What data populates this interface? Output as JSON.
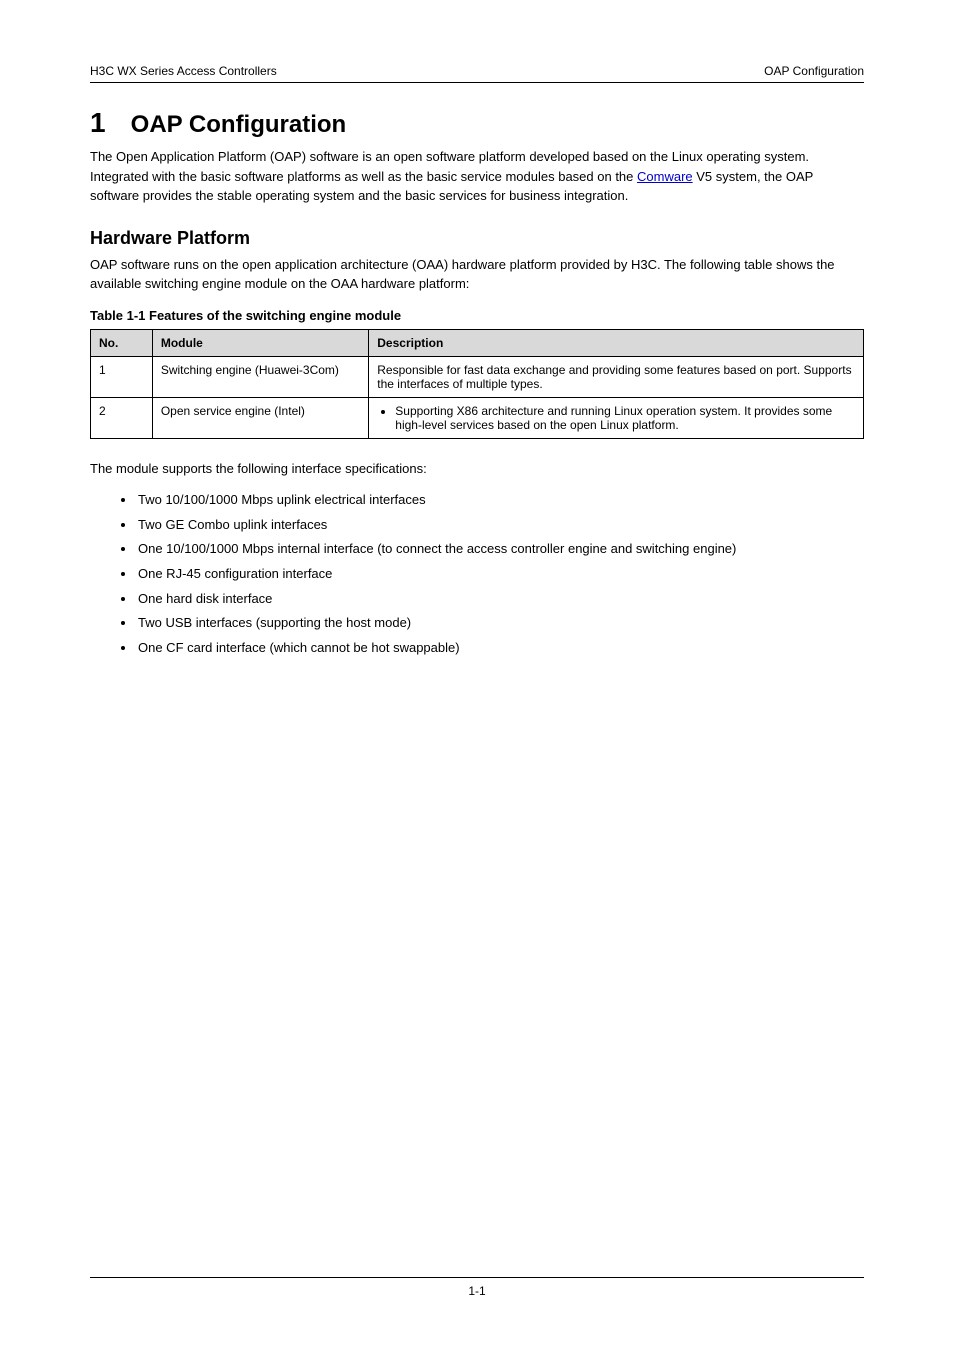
{
  "header": {
    "left": "H3C WX Series Access Controllers",
    "right": "OAP Configuration"
  },
  "title_num": "1",
  "title_text": "OAP Configuration",
  "intro_p1_pre": "The Open Application Platform (OAP) software is an open software platform developed based on the Linux operating system. Integrated with the basic software platforms as well as the basic service modules based on the ",
  "intro_link_text": "Comware",
  "intro_p1_post": " V5 system, the OAP software provides the stable operating system and the basic services for business integration.",
  "h2": "Hardware Platform",
  "p2": "OAP software runs on the open application architecture (OAA) hardware platform provided by H3C. The following table shows the available switching engine module on the OAA hardware platform:",
  "table_caption": "Table 1-1 Features of the switching engine module",
  "table": {
    "headers": [
      "No.",
      "Module",
      "Description"
    ],
    "rows": [
      {
        "no": "1",
        "module": "Switching engine (Huawei-3Com)",
        "desc": "Responsible for fast data exchange and providing some features based on port. Supports the interfaces of multiple types."
      },
      {
        "no": "2",
        "module": "Open service engine (Intel)",
        "desc_bullet": "Supporting X86 architecture and running Linux operation system. It provides some high-level services based on the open Linux platform."
      }
    ]
  },
  "specs_intro": "The module supports the following interface specifications:",
  "specs": [
    "Two 10/100/1000 Mbps uplink electrical interfaces",
    "Two GE Combo uplink interfaces",
    "One 10/100/1000 Mbps internal interface (to connect the access controller engine and switching engine)",
    "One RJ-45 configuration interface",
    "One hard disk interface",
    "Two USB interfaces (supporting the host mode)",
    "One CF card interface (which cannot be hot swappable)"
  ],
  "footer": {
    "left": "",
    "center": "1-1",
    "right": ""
  }
}
